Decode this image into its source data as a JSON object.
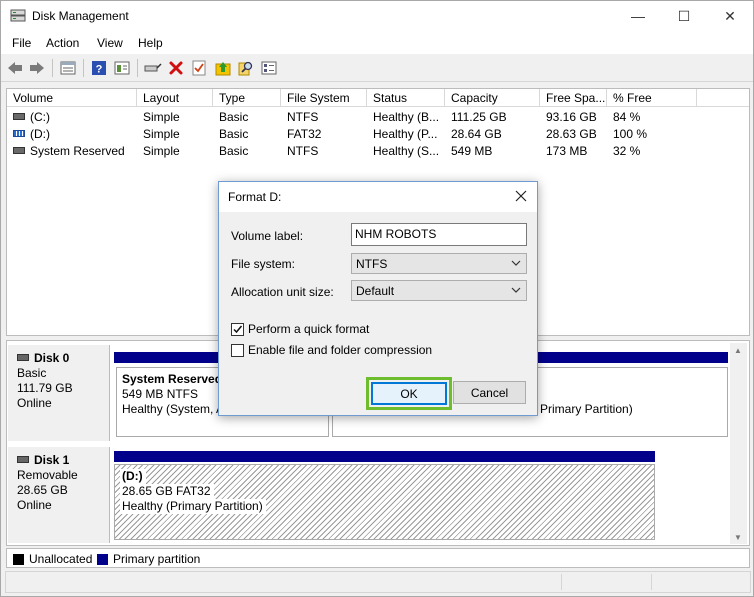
{
  "window": {
    "title": "Disk Management"
  },
  "window_buttons": [
    "—",
    "☐",
    "✕"
  ],
  "menu": [
    "File",
    "Action",
    "View",
    "Help"
  ],
  "toolbar_icons": [
    "back-icon",
    "forward-icon",
    "list-view-icon",
    "help-icon",
    "properties-icon",
    "connect-icon",
    "delete-icon",
    "checklist-icon",
    "folder-up-icon",
    "search-icon",
    "settings-list-icon"
  ],
  "volume_list": {
    "columns": [
      "Volume",
      "Layout",
      "Type",
      "File System",
      "Status",
      "Capacity",
      "Free Spa...",
      "% Free"
    ],
    "rows": [
      {
        "volume": "(C:)",
        "layout": "Simple",
        "type": "Basic",
        "fs": "NTFS",
        "status": "Healthy (B...",
        "capacity": "111.25 GB",
        "free": "93.16 GB",
        "pct": "84 %"
      },
      {
        "volume": "(D:)",
        "layout": "Simple",
        "type": "Basic",
        "fs": "FAT32",
        "status": "Healthy (P...",
        "capacity": "28.64 GB",
        "free": "28.63 GB",
        "pct": "100 %"
      },
      {
        "volume": "System Reserved",
        "layout": "Simple",
        "type": "Basic",
        "fs": "NTFS",
        "status": "Healthy (S...",
        "capacity": "549 MB",
        "free": "173 MB",
        "pct": "32 %"
      }
    ]
  },
  "disks": [
    {
      "name": "Disk 0",
      "kind": "Basic",
      "size": "111.79 GB",
      "state": "Online",
      "partitions": [
        {
          "name": "System Reserved",
          "size": "549 MB NTFS",
          "status": "Healthy (System, A"
        },
        {
          "name": "",
          "size": "",
          "status": "Primary Partition)"
        }
      ]
    },
    {
      "name": "Disk 1",
      "kind": "Removable",
      "size": "28.65 GB",
      "state": "Online",
      "partitions": [
        {
          "name": "(D:)",
          "size": "28.65 GB FAT32",
          "status": "Healthy (Primary Partition)"
        }
      ]
    }
  ],
  "legend": [
    {
      "label": "Unallocated",
      "color": "#000000"
    },
    {
      "label": "Primary partition",
      "color": "#00008b"
    }
  ],
  "dialog": {
    "title": "Format D:",
    "volume_label": "Volume label:",
    "volume_value": "NHM ROBOTS",
    "fs_label": "File system:",
    "fs_value": "NTFS",
    "alloc_label": "Allocation unit size:",
    "alloc_value": "Default",
    "quick_format": "Perform a quick format",
    "quick_format_checked": true,
    "compression": "Enable file and folder compression",
    "compression_checked": false,
    "ok": "OK",
    "cancel": "Cancel"
  },
  "colors": {
    "primary_partition": "#00008b",
    "highlight": "#6ebd2f",
    "focus": "#0078d7"
  }
}
